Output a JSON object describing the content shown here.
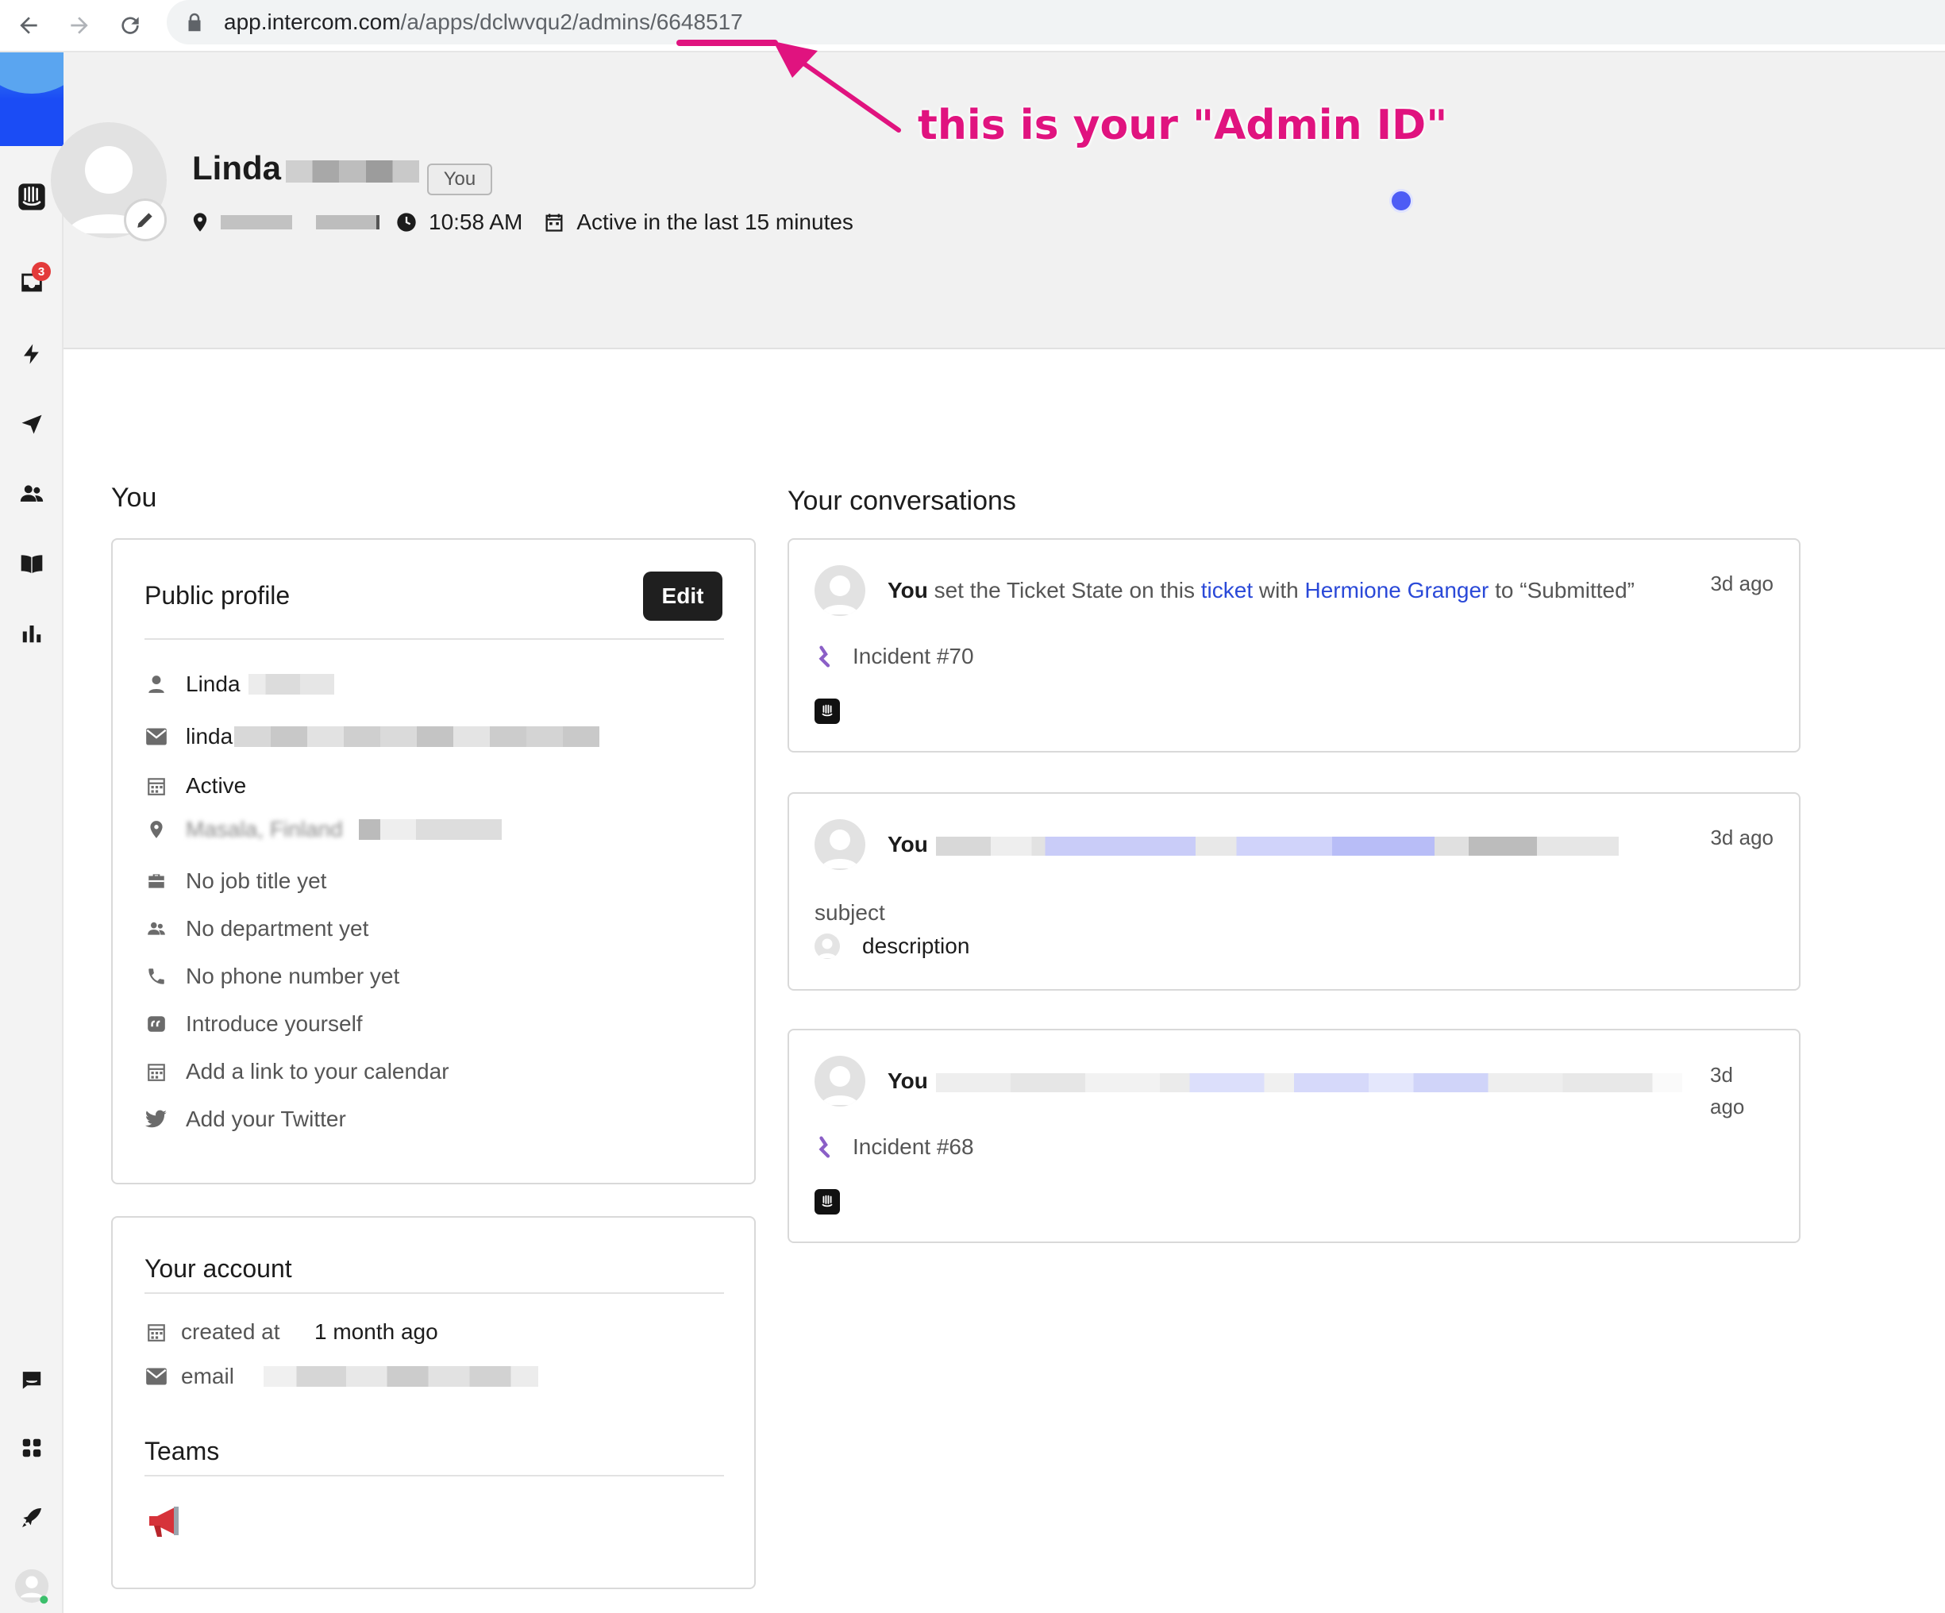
{
  "browser": {
    "url_host": "app.intercom.com",
    "url_path": "/a/apps/dclwvqu2/admins/6648517"
  },
  "annotation": {
    "text": "this is your \"Admin ID\"",
    "color": "#e0137f"
  },
  "sidebar": {
    "inbox_badge": "3",
    "icons": [
      "intercom-logo-icon",
      "inbox-icon",
      "bolt-icon",
      "paper-plane-icon",
      "contacts-icon",
      "book-icon",
      "reports-icon",
      "chat-icon",
      "apps-icon",
      "rocket-icon",
      "user-avatar-icon"
    ]
  },
  "header": {
    "name": "Linda",
    "you_badge": "You",
    "local_time": "10:58 AM",
    "activity": "Active in the last 15 minutes"
  },
  "you_section": {
    "title": "You",
    "public_profile": {
      "title": "Public profile",
      "edit_label": "Edit",
      "rows": [
        {
          "icon": "person-icon",
          "text": "Linda"
        },
        {
          "icon": "mail-icon",
          "text": "linda"
        },
        {
          "icon": "calendar-icon",
          "text": "Active"
        },
        {
          "icon": "location-icon",
          "text": "Masala, Finland"
        },
        {
          "icon": "briefcase-icon",
          "text": "No job title yet"
        },
        {
          "icon": "team-icon",
          "text": "No department yet"
        },
        {
          "icon": "phone-icon",
          "text": "No phone number yet"
        },
        {
          "icon": "quote-icon",
          "text": "Introduce yourself"
        },
        {
          "icon": "calendar-icon",
          "text": "Add a link to your calendar"
        },
        {
          "icon": "twitter-icon",
          "text": "Add your Twitter"
        }
      ]
    },
    "account": {
      "title": "Your account",
      "created_label": "created at",
      "created_value": "1 month ago",
      "email_label": "email",
      "teams_title": "Teams"
    }
  },
  "conversations": {
    "title": "Your conversations",
    "items": [
      {
        "actor": "You",
        "text_1": " set the Ticket State on this ",
        "link_1": "ticket",
        "text_2": " with ",
        "link_2": "Hermione Granger",
        "text_3": " to “Submitted”",
        "time": "3d ago",
        "subtitle": "Incident #70"
      },
      {
        "actor": "You",
        "time": "3d ago",
        "subject": "subject",
        "description": "description"
      },
      {
        "actor": "You",
        "time_1": "3d",
        "time_2": "ago",
        "subtitle": "Incident #68"
      }
    ]
  }
}
